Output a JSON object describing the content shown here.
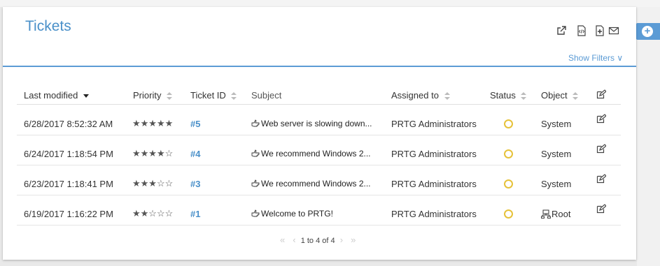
{
  "panel": {
    "title": "Tickets",
    "show_filters_label": "Show Filters ∨"
  },
  "toolbar_icons": [
    "external-link-icon",
    "code-file-icon",
    "new-document-icon",
    "mail-icon"
  ],
  "columns": [
    {
      "label": "Last modified",
      "sort": "desc"
    },
    {
      "label": "Priority",
      "sort": "both"
    },
    {
      "label": "Ticket ID",
      "sort": "both"
    },
    {
      "label": "Subject",
      "sort": "none"
    },
    {
      "label": "Assigned to",
      "sort": "both"
    },
    {
      "label": "Status",
      "sort": "both"
    },
    {
      "label": "Object",
      "sort": "both"
    }
  ],
  "rows": [
    {
      "modified": "6/28/2017 8:52:32 AM",
      "priority": 5,
      "stars": "★★★★★",
      "id": "#5",
      "subject": "Web server is slowing down...",
      "assigned": "PRTG Administrators",
      "status": "open",
      "object": "System",
      "object_icon": "none"
    },
    {
      "modified": "6/24/2017 1:18:54 PM",
      "priority": 4,
      "stars": "★★★★☆",
      "id": "#4",
      "subject": "We recommend Windows 2...",
      "assigned": "PRTG Administrators",
      "status": "open",
      "object": "System",
      "object_icon": "none"
    },
    {
      "modified": "6/23/2017 1:18:41 PM",
      "priority": 3,
      "stars": "★★★☆☆",
      "id": "#3",
      "subject": "We recommend Windows 2...",
      "assigned": "PRTG Administrators",
      "status": "open",
      "object": "System",
      "object_icon": "none"
    },
    {
      "modified": "6/19/2017 1:16:22 PM",
      "priority": 2,
      "stars": "★★☆☆☆",
      "id": "#1",
      "subject": "Welcome to PRTG!",
      "assigned": "PRTG Administrators",
      "status": "open",
      "object": "Root",
      "object_icon": "group-icon"
    }
  ],
  "pager": {
    "text": "1 to 4 of 4",
    "first": "«",
    "prev": "‹",
    "next": "›",
    "last": "»"
  },
  "colors": {
    "accent": "#4a90c9",
    "status_open": "#e6c23a"
  }
}
